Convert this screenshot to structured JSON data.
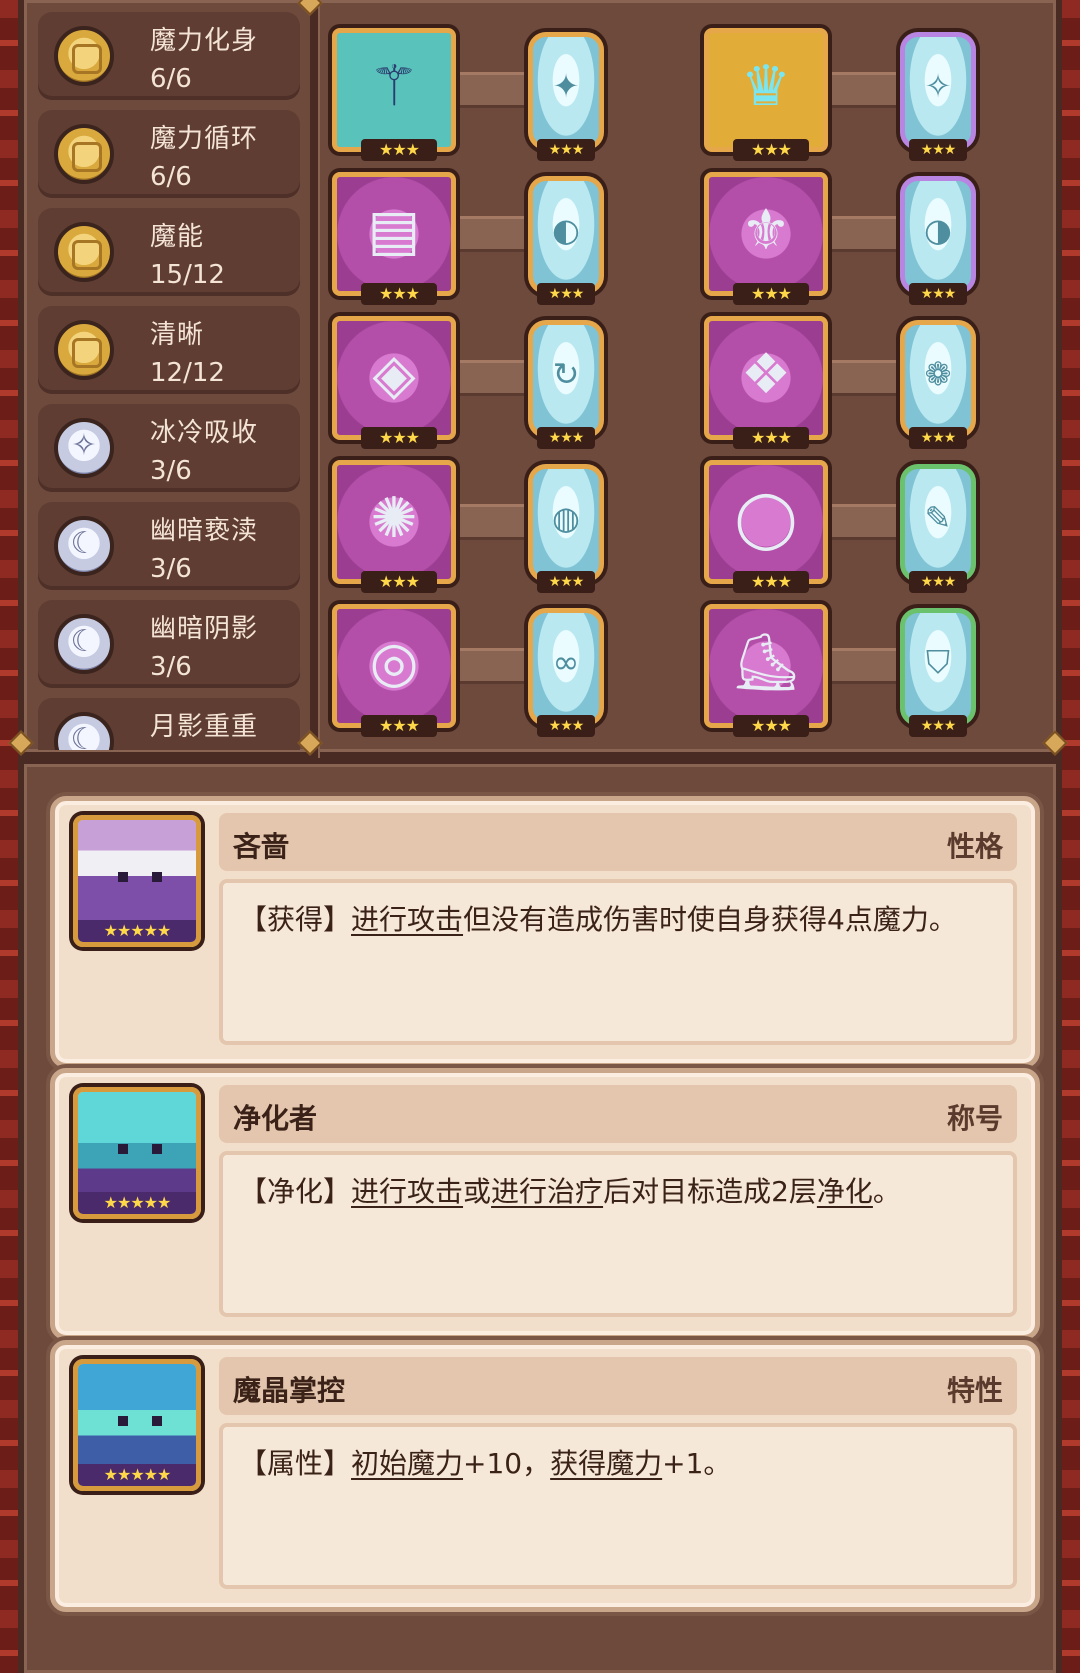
{
  "stats": [
    {
      "name": "魔力化身",
      "value": "6/6",
      "icon": "gold-coin-icon"
    },
    {
      "name": "魔力循环",
      "value": "6/6",
      "icon": "gold-coin-icon"
    },
    {
      "name": "魔能",
      "value": "15/12",
      "icon": "gold-coin-icon"
    },
    {
      "name": "清晰",
      "value": "12/12",
      "icon": "gold-coin-icon"
    },
    {
      "name": "冰冷吸收",
      "value": "3/6",
      "icon": "frost-icon"
    },
    {
      "name": "幽暗亵渎",
      "value": "3/6",
      "icon": "moon-icon"
    },
    {
      "name": "幽暗阴影",
      "value": "3/6",
      "icon": "moon-icon"
    },
    {
      "name": "月影重重",
      "value": "",
      "icon": "moon-icon"
    }
  ],
  "equipment": [
    {
      "item": "staff-icon",
      "stars": "★★★",
      "rune_stars": "★★★"
    },
    {
      "item": "crystal-crown-icon",
      "stars": "★★★",
      "rune_stars": "★★★"
    },
    {
      "item": "spellbook-icon",
      "stars": "★★★",
      "rune_stars": "★★★"
    },
    {
      "item": "dark-robe-icon",
      "stars": "★★★",
      "rune_stars": "★★★"
    },
    {
      "item": "amulet-icon",
      "stars": "★★★",
      "rune_stars": "★★★"
    },
    {
      "item": "ice-crystal-icon",
      "stars": "★★★",
      "rune_stars": "★★★"
    },
    {
      "item": "golden-medallion-icon",
      "stars": "★★★",
      "rune_stars": "★★★"
    },
    {
      "item": "silver-ring-band-icon",
      "stars": "★★★",
      "rune_stars": "★★★"
    },
    {
      "item": "jeweled-ring-icon",
      "stars": "★★★",
      "rune_stars": "★★★"
    },
    {
      "item": "dark-boots-icon",
      "stars": "★★★",
      "rune_stars": "★★★"
    }
  ],
  "cards": [
    {
      "title": "吝啬",
      "tag": "性格",
      "stars": "★★★★★",
      "desc_parts": [
        "【获得】",
        "进行攻击",
        "但没有造成伤害时使自身获得4点魔力。"
      ]
    },
    {
      "title": "净化者",
      "tag": "称号",
      "stars": "★★★★★",
      "desc_parts": [
        "【净化】",
        "进行攻击",
        "或",
        "进行治疗",
        "后对目标造成2层",
        "净化",
        "。"
      ]
    },
    {
      "title": "魔晶掌控",
      "tag": "特性",
      "stars": "★★★★★",
      "desc_parts": [
        "【属性】",
        "初始魔力",
        "+10，",
        "获得魔力",
        "+1。"
      ]
    }
  ]
}
